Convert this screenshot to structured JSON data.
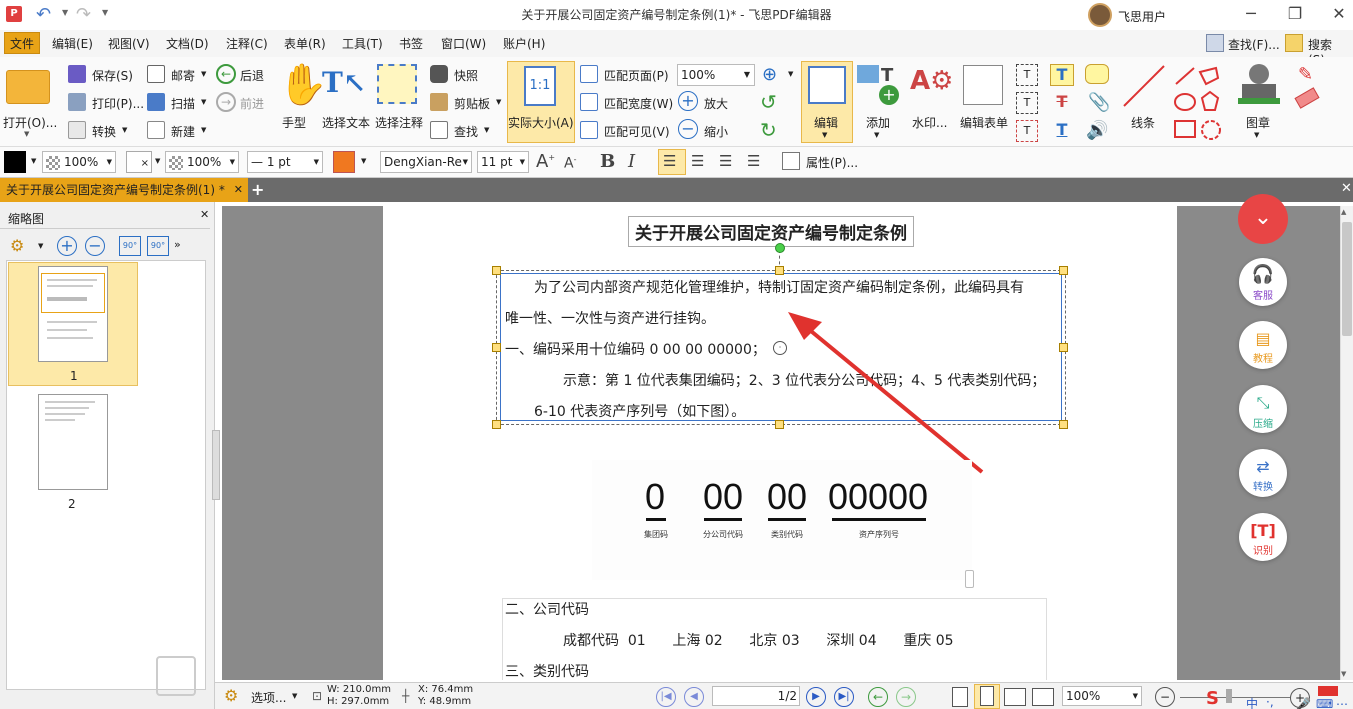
{
  "window": {
    "title": "关于开展公司固定资产编号制定条例(1)* - 飞思PDF编辑器",
    "user_name": "飞思用户"
  },
  "menu": {
    "file": "文件",
    "items": [
      "编辑(E)",
      "视图(V)",
      "文档(D)",
      "注释(C)",
      "表单(R)",
      "工具(T)",
      "书签",
      "窗口(W)",
      "账户(H)"
    ],
    "find": "查找(F)...",
    "search": "搜索(S)..."
  },
  "ribbon": {
    "open": "打开(O)...",
    "save": "保存(S)",
    "print": "打印(P)...",
    "convert": "转换",
    "mail": "邮寄",
    "scan": "扫描",
    "new": "新建",
    "back": "后退",
    "forward": "前进",
    "hand": "手型",
    "select_text": "选择文本",
    "select_annot": "选择注释",
    "snapshot": "快照",
    "clipboard": "剪贴板",
    "find": "查找",
    "actual_size": "实际大小(A)",
    "fit_page": "匹配页面(P)",
    "fit_width": "匹配宽度(W)",
    "fit_visible": "匹配可见(V)",
    "zoom_value": "100%",
    "zoom_in": "放大",
    "zoom_out": "缩小",
    "edit": "编辑",
    "add": "添加",
    "watermark": "水印...",
    "edit_form": "编辑表单",
    "lines": "线条",
    "stamp": "图章"
  },
  "format": {
    "fill_opacity": "100%",
    "stroke_opacity": "100%",
    "line_width": "— 1 pt",
    "font_name": "DengXian-Re",
    "font_size": "11 pt",
    "properties": "属性(P)..."
  },
  "tab": {
    "label": "关于开展公司固定资产编号制定条例(1) *"
  },
  "thumbnails": {
    "title": "缩略图",
    "pages": [
      "1",
      "2"
    ]
  },
  "document": {
    "title": "关于开展公司固定资产编号制定条例",
    "para1_line1": "为了公司内部资产规范化管理维护，特制订固定资产编码制定条例，此编码具有",
    "para1_line2": "唯一性、一次性与资产进行挂钩。",
    "item1": "一、编码采用十位编码  0 00 00 00000；",
    "item1_note": "示意：第 1 位代表集团编码；2、3 位代表分公司代码；4、5 代表类别代码；",
    "item1_note2": "6-10 代表资产序列号（如下图）。",
    "digits": [
      {
        "value": "0",
        "label": "集团码"
      },
      {
        "value": "00",
        "label": "分公司代码"
      },
      {
        "value": "00",
        "label": "类别代码"
      },
      {
        "value": "00000",
        "label": "资产序列号"
      }
    ],
    "section2": "二、公司代码",
    "companies": "成都代码  01      上海 02      北京 03      深圳 04      重庆 05",
    "section3": "三、类别代码"
  },
  "side_buttons": {
    "service": "客服",
    "tutorial": "教程",
    "compress": "压缩",
    "convert": "转换",
    "ocr": "识别"
  },
  "status": {
    "options": "选项...",
    "width": "W: 210.0mm",
    "height": "H: 297.0mm",
    "x": "X:   76.4mm",
    "y": "Y:   48.9mm",
    "page": "1",
    "page_total": "/2",
    "zoom": "100%"
  },
  "colors": {
    "accent": "#e8a317",
    "highlight": "#fde9a8",
    "side_red": "#e84545",
    "selection_blue": "#3b73c8"
  }
}
